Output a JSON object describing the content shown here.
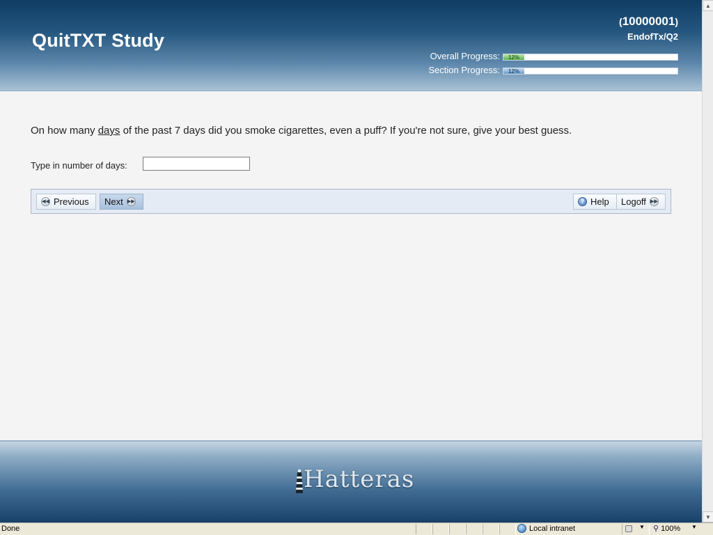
{
  "header": {
    "study_title": "QuitTXT Study",
    "participant_id": "10000001",
    "form_path": "EndofTx/Q2",
    "overall_progress": {
      "label": "Overall Progress:",
      "percent_text": "12%",
      "fraction": 0.12
    },
    "section_progress": {
      "label": "Section Progress:",
      "percent_text": "12%",
      "fraction": 0.12
    }
  },
  "question": {
    "text_before": "On how many ",
    "emphasis": "days",
    "text_after": " of the past 7 days did you smoke cigarettes, even a puff? If you're not sure, give your best guess.",
    "answer_label": "Type in number of days:",
    "answer_value": ""
  },
  "nav": {
    "previous_label": "Previous",
    "next_label": "Next",
    "help_label": "Help",
    "logoff_label": "Logoff"
  },
  "footer": {
    "brand": "Hatteras"
  },
  "statusbar": {
    "status": "Done",
    "zone": "Local intranet",
    "zoom": "100%"
  },
  "colors": {
    "header_dark": "#0f3d64",
    "header_light": "#a9c2d6",
    "overall_fill": "#5fb14f",
    "section_fill": "#6c9bc9",
    "nav_bar_bg": "#e4ebf4"
  }
}
